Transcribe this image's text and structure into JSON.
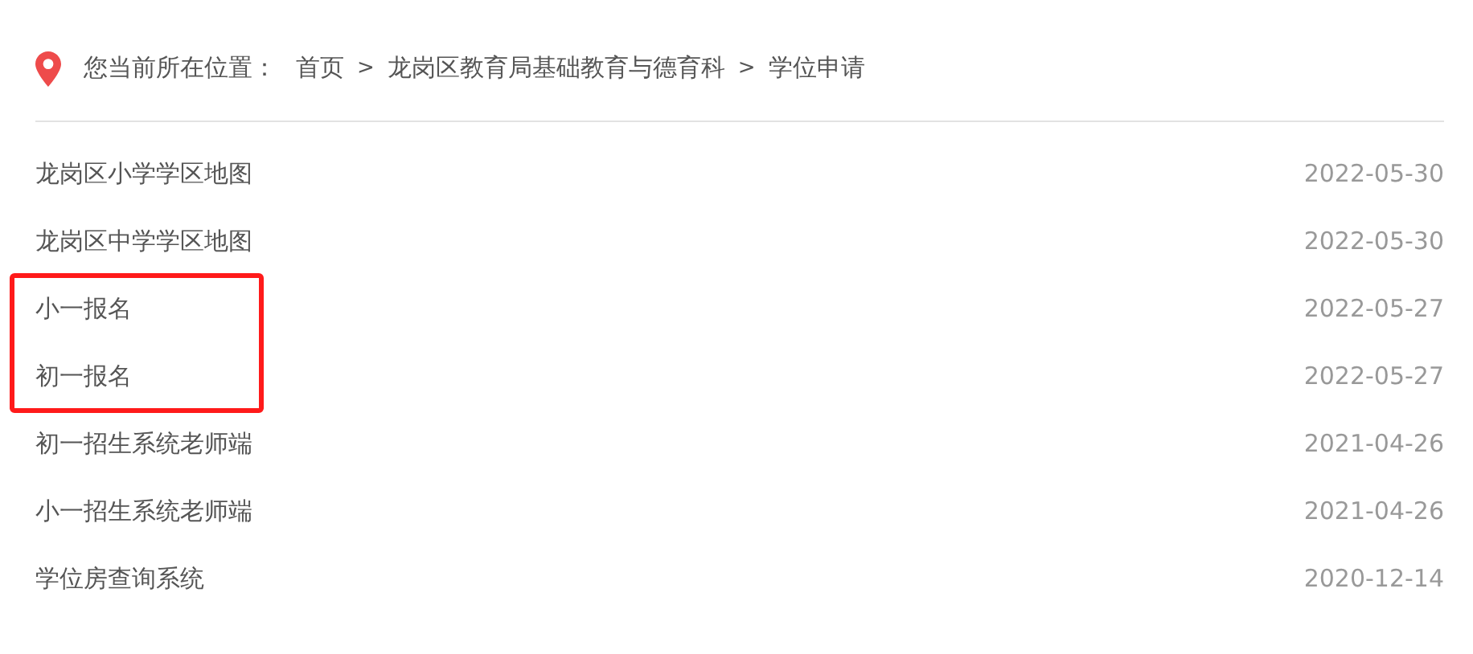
{
  "breadcrumb": {
    "label": "您当前所在位置：",
    "path": [
      "首页",
      "龙岗区教育局基础教育与德育科",
      "学位申请"
    ],
    "separator": ">"
  },
  "items": [
    {
      "title": "龙岗区小学学区地图",
      "date": "2022-05-30",
      "marked": false
    },
    {
      "title": "龙岗区中学学区地图",
      "date": "2022-05-30",
      "marked": false
    },
    {
      "title": "小一报名",
      "date": "2022-05-27",
      "marked": true
    },
    {
      "title": "初一报名",
      "date": "2022-05-27",
      "marked": true
    },
    {
      "title": "初一招生系统老师端",
      "date": "2021-04-26",
      "marked": false
    },
    {
      "title": "小一招生系统老师端",
      "date": "2021-04-26",
      "marked": false
    },
    {
      "title": "学位房查询系统",
      "date": "2020-12-14",
      "marked": false
    }
  ]
}
